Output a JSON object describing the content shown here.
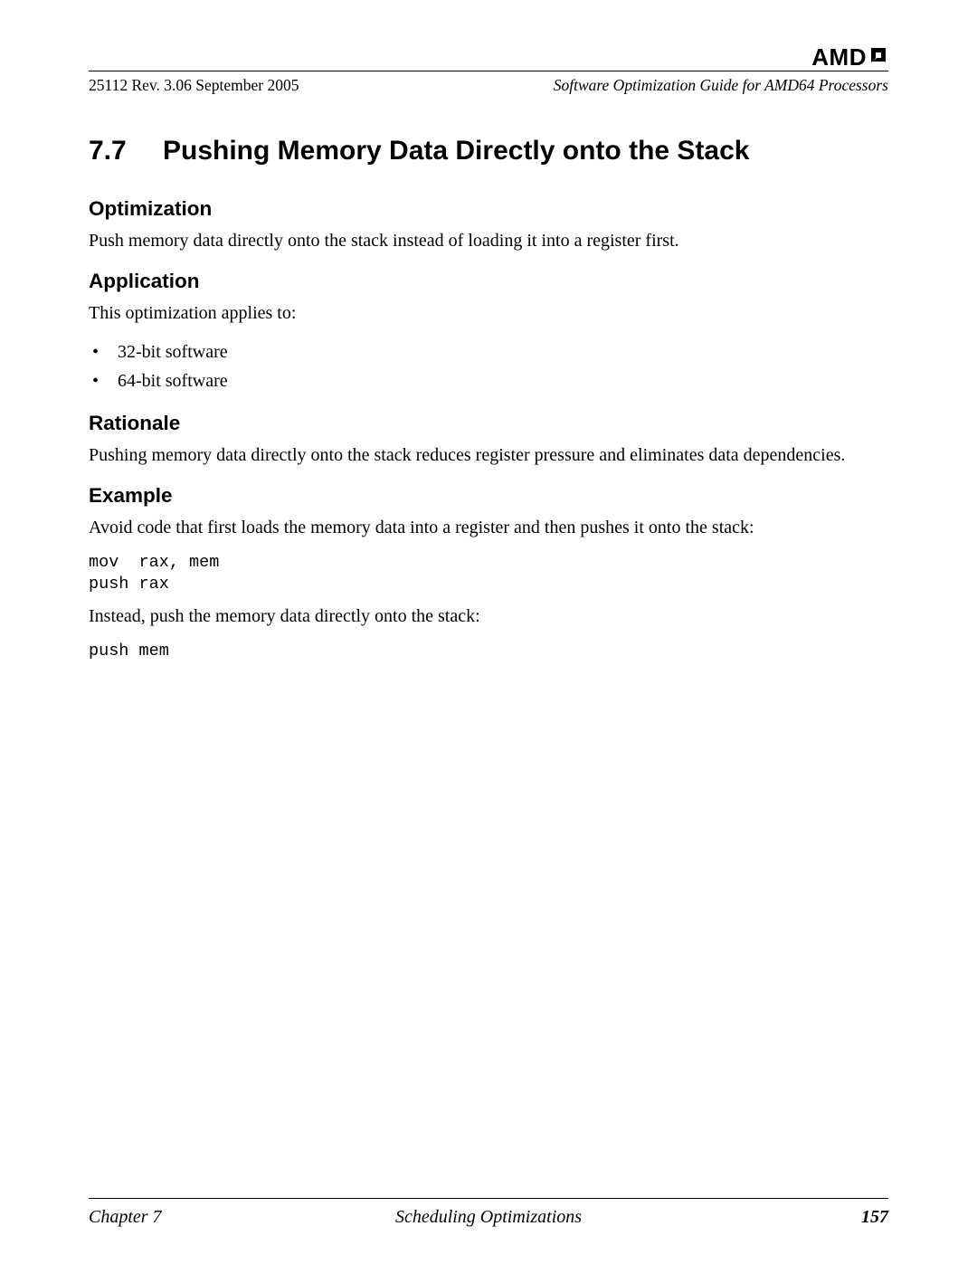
{
  "brand": {
    "name": "AMD"
  },
  "header": {
    "left": "25112   Rev. 3.06   September 2005",
    "right": "Software Optimization Guide for AMD64 Processors"
  },
  "section": {
    "number": "7.7",
    "title": "Pushing Memory Data Directly onto the Stack"
  },
  "subs": {
    "optimization": {
      "heading": "Optimization",
      "text": "Push memory data directly onto the stack instead of loading it into a register first."
    },
    "application": {
      "heading": "Application",
      "intro": "This optimization applies to:",
      "items": [
        "32-bit software",
        "64-bit software"
      ]
    },
    "rationale": {
      "heading": "Rationale",
      "text": "Pushing memory data directly onto the stack reduces register pressure and eliminates data dependencies."
    },
    "example": {
      "heading": "Example",
      "intro1": "Avoid code that first loads the memory data into a register and then pushes it onto the stack:",
      "code1": "mov  rax, mem\npush rax",
      "intro2": "Instead, push the memory data directly onto the stack:",
      "code2": "push mem"
    }
  },
  "footer": {
    "left": "Chapter 7",
    "center": "Scheduling Optimizations",
    "right": "157"
  }
}
